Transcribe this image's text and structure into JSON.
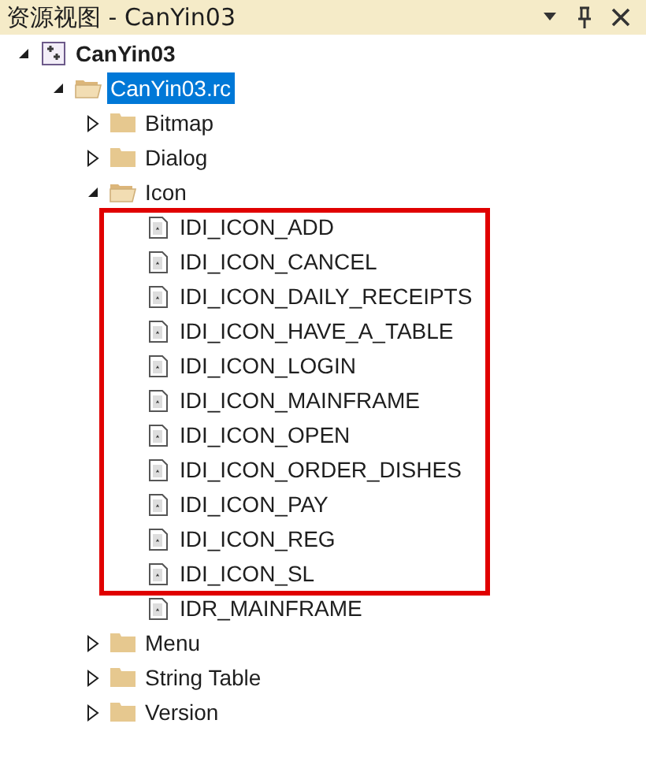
{
  "window": {
    "title": "资源视图 - CanYin03"
  },
  "tree": [
    {
      "label": "CanYin03",
      "kind": "project",
      "expanded": true,
      "selected": false,
      "children": [
        {
          "label": "CanYin03.rc",
          "kind": "folder",
          "expanded": true,
          "selected": true,
          "children": [
            {
              "label": "Bitmap",
              "kind": "folder",
              "expanded": false,
              "selected": false
            },
            {
              "label": "Dialog",
              "kind": "folder",
              "expanded": false,
              "selected": false
            },
            {
              "label": "Icon",
              "kind": "folder",
              "expanded": true,
              "selected": false,
              "children": [
                {
                  "kind": "annotation_frame",
                  "children": [
                    {
                      "label": "IDI_ICON_ADD",
                      "kind": "resource",
                      "selected": false
                    },
                    {
                      "label": "IDI_ICON_CANCEL",
                      "kind": "resource",
                      "selected": false
                    },
                    {
                      "label": "IDI_ICON_DAILY_RECEIPTS",
                      "kind": "resource",
                      "selected": false
                    },
                    {
                      "label": "IDI_ICON_HAVE_A_TABLE",
                      "kind": "resource",
                      "selected": false
                    },
                    {
                      "label": "IDI_ICON_LOGIN",
                      "kind": "resource",
                      "selected": false
                    },
                    {
                      "label": "IDI_ICON_MAINFRAME",
                      "kind": "resource",
                      "selected": false
                    },
                    {
                      "label": "IDI_ICON_OPEN",
                      "kind": "resource",
                      "selected": false
                    },
                    {
                      "label": "IDI_ICON_ORDER_DISHES",
                      "kind": "resource",
                      "selected": false
                    },
                    {
                      "label": "IDI_ICON_PAY",
                      "kind": "resource",
                      "selected": false
                    },
                    {
                      "label": "IDI_ICON_REG",
                      "kind": "resource",
                      "selected": false
                    },
                    {
                      "label": "IDI_ICON_SL",
                      "kind": "resource",
                      "selected": false
                    }
                  ]
                },
                {
                  "label": "IDR_MAINFRAME",
                  "kind": "resource",
                  "selected": false
                }
              ]
            },
            {
              "label": "Menu",
              "kind": "folder",
              "expanded": false,
              "selected": false
            },
            {
              "label": "String Table",
              "kind": "folder",
              "expanded": false,
              "selected": false
            },
            {
              "label": "Version",
              "kind": "folder",
              "expanded": false,
              "selected": false
            }
          ]
        }
      ]
    }
  ]
}
